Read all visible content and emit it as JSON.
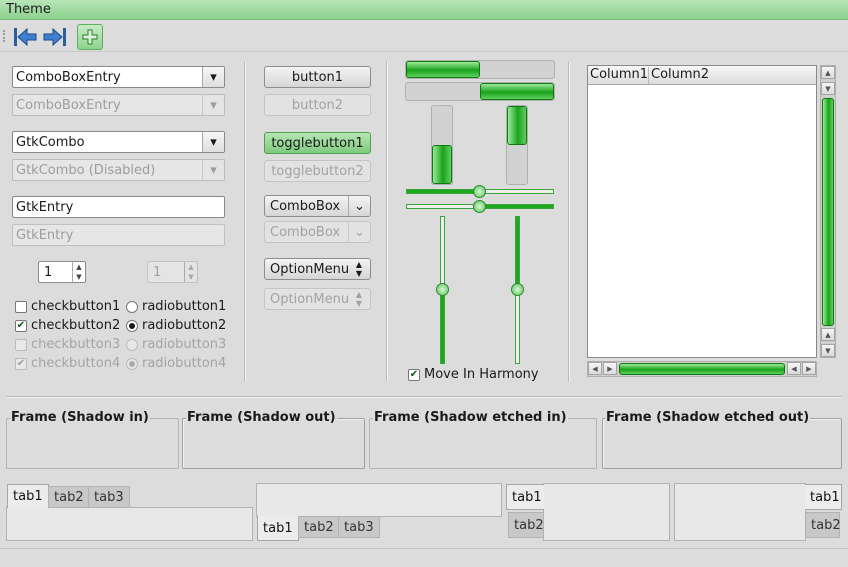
{
  "window": {
    "title": "Theme"
  },
  "toolbar": {
    "items": [
      "back-icon",
      "forward-icon",
      "add-icon"
    ]
  },
  "combos": {
    "combo_entry": "ComboBoxEntry",
    "combo_entry_disabled": "ComboBoxEntry",
    "gtk_combo": "GtkCombo",
    "gtk_combo_disabled": "GtkCombo (Disabled)"
  },
  "entries": {
    "entry": "GtkEntry",
    "entry_disabled": "GtkEntry"
  },
  "spins": {
    "spin": "1",
    "spin_disabled": "1"
  },
  "checks": {
    "check1": "checkbutton1",
    "check2": "checkbutton2",
    "check3": "checkbutton3",
    "check4": "checkbutton4",
    "check_states": [
      false,
      true,
      false,
      true
    ]
  },
  "radios": {
    "radio1": "radiobutton1",
    "radio2": "radiobutton2",
    "radio3": "radiobutton3",
    "radio4": "radiobutton4",
    "selected": 2
  },
  "buttons": {
    "button1": "button1",
    "button2": "button2",
    "toggle1": "togglebutton1",
    "toggle2": "togglebutton2",
    "combobox": "ComboBox",
    "combobox_disabled": "ComboBox",
    "optionmenu": "OptionMenu",
    "optionmenu_disabled": "OptionMenu"
  },
  "ranges": {
    "progress_h1": 0.5,
    "progress_h2": 0.5,
    "progress_v1": 0.5,
    "progress_v2": 0.5,
    "scale_h1": 0.5,
    "scale_h2": 0.5,
    "scale_v1": 0.5,
    "scale_v2": 0.5
  },
  "harmony": {
    "label": "Move In Harmony",
    "checked": true
  },
  "tree": {
    "columns": [
      "Column1",
      "Column2"
    ]
  },
  "frames": {
    "shadow_in": "Frame (Shadow in)",
    "shadow_out": "Frame (Shadow out)",
    "shadow_etched_in": "Frame (Shadow etched in)",
    "shadow_etched_out": "Frame (Shadow etched out)"
  },
  "notebooks": {
    "tabs_top": [
      "tab1",
      "tab2",
      "tab3"
    ],
    "tabs_bottom": [
      "tab1",
      "tab2",
      "tab3"
    ],
    "tabs_left": [
      "tab1",
      "tab2"
    ],
    "tabs_right": [
      "tab1",
      "tab2"
    ]
  },
  "colors": {
    "accent": "#1ea81e",
    "title_bar": "#a3dca3",
    "background": "#dcdcdc"
  }
}
